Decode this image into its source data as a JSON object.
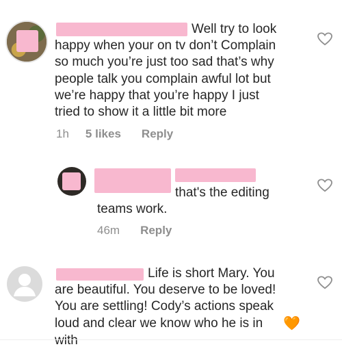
{
  "comments": [
    {
      "text": "Well try to look\nhappy when your on tv don’t Complain\nso much you’re just too sad that’s why\npeople talk you complain awful lot but\nwe’re happy that you’re happy I just\ntried to show it a little bit more",
      "time": "1h",
      "likes": "5 likes",
      "reply_label": "Reply"
    },
    {
      "text_line1": "that's the editing",
      "text_line2": "teams work.",
      "time": "46m",
      "reply_label": "Reply"
    },
    {
      "text": "Life is short Mary.  You\nare beautiful.  You deserve to be loved!\nYou are settling!  Cody’s actions speak\nloud and clear we know who he is in",
      "overflow_text": "with",
      "emoji": "🧡"
    }
  ],
  "colors": {
    "redaction": "#f8b8cf",
    "meta_text": "#8e8e8e",
    "heart_outline": "#8e8e8e",
    "emoji_heart": "#f59a23"
  },
  "icons": {
    "like": "heart-outline-icon",
    "default_avatar": "default-avatar-icon"
  }
}
